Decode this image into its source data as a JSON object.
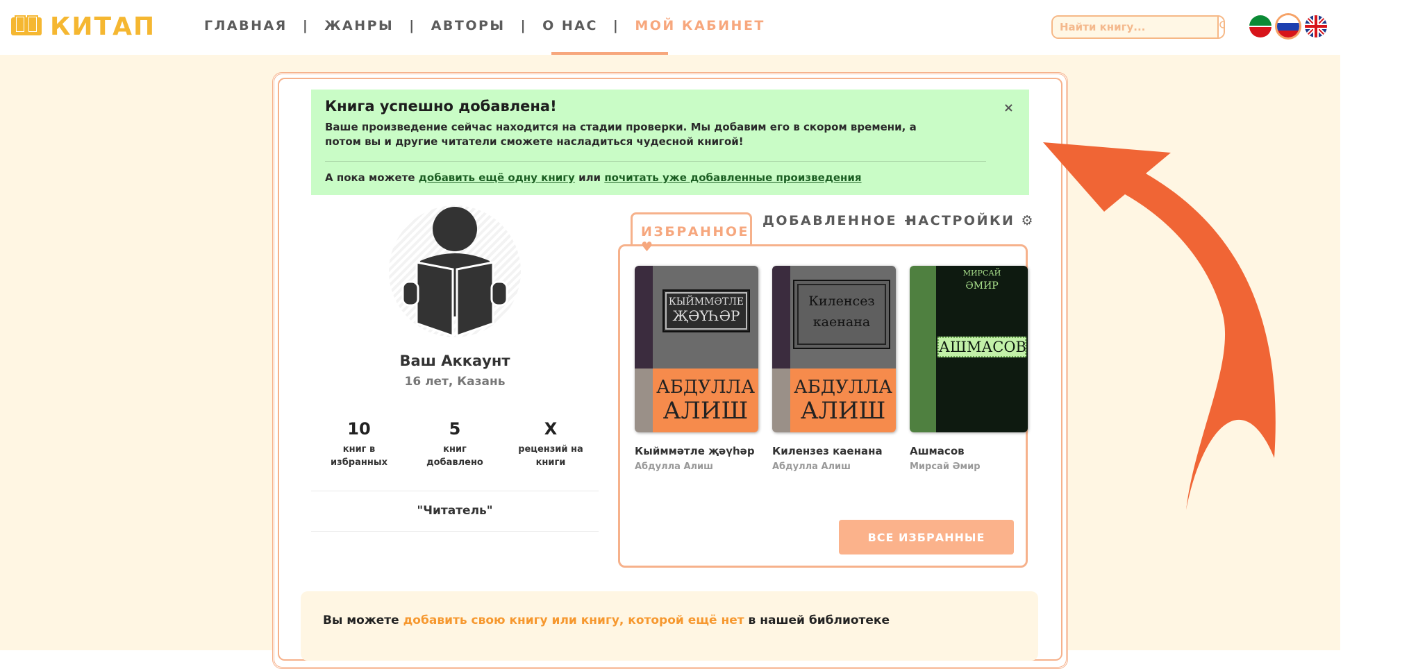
{
  "header": {
    "logo_text": "КИТАП",
    "nav": [
      {
        "label": "ГЛАВНАЯ",
        "active": false
      },
      {
        "label": "ЖАНРЫ",
        "active": false
      },
      {
        "label": "АВТОРЫ",
        "active": false
      },
      {
        "label": "О НАС",
        "active": false
      },
      {
        "label": "МОЙ КАБИНЕТ",
        "active": true
      }
    ],
    "separator": "|",
    "search_placeholder": "Найти книгу...",
    "languages": [
      "tatar-flag",
      "russia-flag",
      "uk-flag"
    ],
    "selected_language": "russia-flag"
  },
  "alert": {
    "title": "Книга успешно добавлена!",
    "message": "Ваше произведение сейчас находится на стадии проверки. Мы добавим его в скором времени, а потом вы и другие читатели сможете насладиться чудесной книгой!",
    "more_prefix": "А пока можете",
    "link1": "добавить ещё одну книгу",
    "more_middle": "или",
    "link2": "почитать уже добавленные произведения",
    "close": "×"
  },
  "profile": {
    "name": "Ваш Аккаунт",
    "sub": "16 лет, Казань",
    "stats": [
      {
        "value": "10",
        "label1": "книг в",
        "label2": "избранных"
      },
      {
        "value": "5",
        "label1": "книг",
        "label2": "добавлено"
      },
      {
        "value": "X",
        "label1": "рецензий на",
        "label2": "книги"
      }
    ],
    "role": "\"Читатель\""
  },
  "tabs": [
    {
      "label": "ИЗБРАННОЕ ♥",
      "active": true
    },
    {
      "label": "ДОБАВЛЕННОЕ +",
      "active": false
    },
    {
      "label": "НАСТРОЙКИ ⚙",
      "active": false
    }
  ],
  "books": [
    {
      "title": "Кыйммәтле җәүһәр",
      "author": "Абдулла Алиш",
      "cover_top1": "КЫЙММӘТЛЕ",
      "cover_top2": "ҖӘҮҺӘР",
      "cover_bottom1": "АБДУЛЛА",
      "cover_bottom2": "АЛИШ"
    },
    {
      "title": "Килензез каенана",
      "author": "Абдулла Алиш",
      "cover_top1": "Киленсез",
      "cover_top2": "каенана",
      "cover_bottom1": "АБДУЛЛА",
      "cover_bottom2": "АЛИШ"
    },
    {
      "title": "Ашмасов",
      "author": "Мирсай Әмир",
      "cover_top1": "МИРСАЙ",
      "cover_top2": "ӘМИР",
      "cover_bottom1": "АШМАСОВ",
      "cover_bottom2": ""
    }
  ],
  "all_favorites_button": "ВСЕ ИЗБРАННЫЕ",
  "bottom": {
    "prefix": "Вы можете",
    "link": "добавить свою книгу или книгу, которой ещё нет",
    "suffix": "в нашей библиотеке"
  },
  "colors": {
    "accent": "#f7a77d",
    "logo": "#f5b731",
    "alert_bg": "#c9fcc6",
    "page_bg": "#fff6e3",
    "arrow": "#f06535"
  }
}
